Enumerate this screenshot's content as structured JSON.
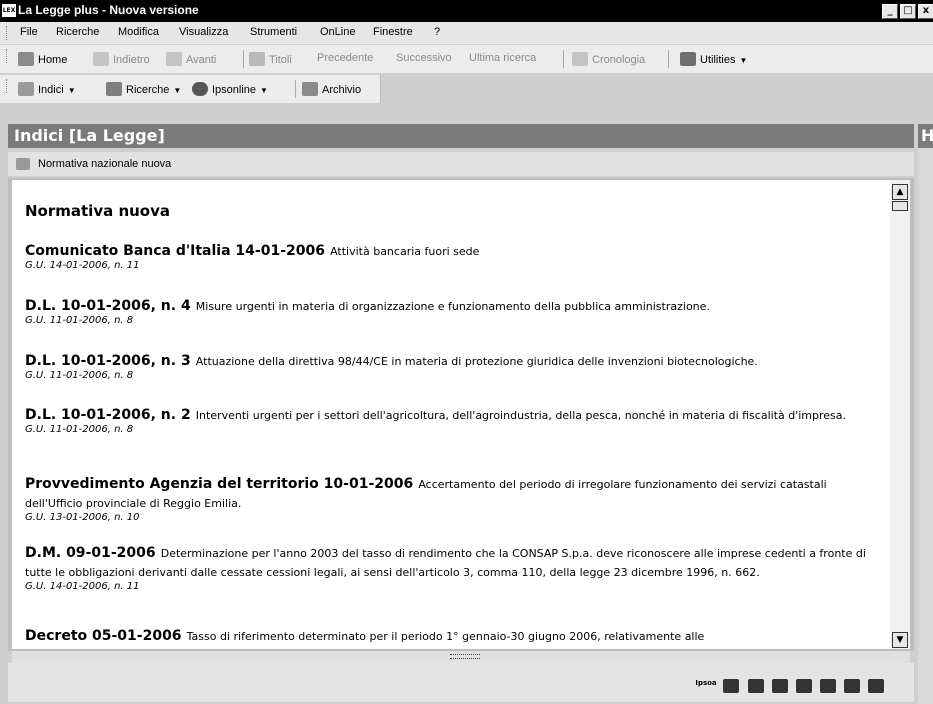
{
  "window": {
    "title": "La Legge plus - Nuova versione",
    "app_icon": "lex-logo-icon"
  },
  "menu": [
    "File",
    "Ricerche",
    "Modifica",
    "Visualizza",
    "Strumenti",
    "OnLine",
    "Finestre",
    "?"
  ],
  "toolbar1": {
    "home": "Home",
    "back": "Indietro",
    "forward": "Avanti",
    "titles": "Titoli",
    "previous": "Precedente",
    "next": "Successivo",
    "last_search": "Ultima ricerca",
    "history": "Cronologia",
    "utilities": "Utilities"
  },
  "toolbar2": {
    "indexes": "Indici",
    "searches": "Ricerche",
    "ipsonline": "Ipsonline",
    "archive": "Archivio"
  },
  "panel": {
    "title": "Indici [La Legge]",
    "breadcrumb": "Normativa nazionale nuova",
    "right_title": "H"
  },
  "document": {
    "heading": "Normativa nuova",
    "entries": [
      {
        "title": "Comunicato Banca d'Italia 14-01-2006",
        "desc": "Attività bancaria fuori sede",
        "gu": "G.U. 14-01-2006, n. 11"
      },
      {
        "title": "D.L. 10-01-2006, n. 4",
        "desc": "Misure urgenti in materia di organizzazione e funzionamento della pubblica amministrazione.",
        "gu": "G.U. 11-01-2006, n. 8"
      },
      {
        "title": "D.L. 10-01-2006, n. 3",
        "desc": "Attuazione della direttiva 98/44/CE in materia di protezione giuridica delle invenzioni biotecnologiche.",
        "gu": "G.U. 11-01-2006, n. 8"
      },
      {
        "title": "D.L. 10-01-2006, n. 2",
        "desc": "Interventi urgenti per i settori dell'agricoltura, dell'agroindustria, della pesca, nonché in materia di fiscalità d'impresa.",
        "gu": "G.U. 11-01-2006, n. 8"
      },
      {
        "title": "Provvedimento Agenzia del territorio 10-01-2006",
        "desc": "Accertamento del periodo di irregolare funzionamento dei servizi catastali dell'Ufficio provinciale di Reggio Emilia.",
        "gu": "G.U. 13-01-2006, n. 10"
      },
      {
        "title": "D.M. 09-01-2006",
        "desc": "Determinazione per l'anno 2003 del tasso di rendimento che la CONSAP S.p.a. deve riconoscere alle imprese cedenti a fronte di tutte le obbligazioni derivanti dalle cessate cessioni legali, ai sensi dell'articolo 3, comma 110, della legge 23 dicembre 1996, n. 662.",
        "gu": "G.U. 14-01-2006, n. 11"
      },
      {
        "title": "Decreto 05-01-2006",
        "desc": "Tasso di riferimento determinato per il periodo 1° gennaio-30 giugno 2006, relativamente alle",
        "gu": ""
      }
    ]
  },
  "status_icons": [
    "lex-logo-icon",
    "map-icon",
    "grid-icon",
    "book-icon",
    "people-icon",
    "graduation-cap-icon",
    "card-icon",
    "coins-icon"
  ],
  "status_logo_text": "Ipsoa"
}
